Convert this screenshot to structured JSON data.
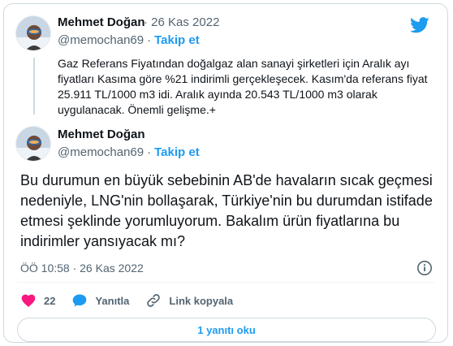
{
  "quoted_tweet": {
    "author_name": "Mehmet Doğan",
    "date": "26 Kas 2022",
    "handle": "@memochan69",
    "follow_label": "Takip et",
    "separator": "·",
    "dot_before_date": "·",
    "text": "Gaz Referans Fiyatından doğalgaz alan sanayi şirketleri için Aralık ayı fiyatları Kasıma göre %21 indirimli gerçekleşecek. Kasım'da referans fiyat 25.911 TL/1000 m3 idi. Aralık ayında 20.543 TL/1000 m3 olarak uygulanacak. Önemli gelişme.+"
  },
  "main_tweet": {
    "author_name": "Mehmet Doğan",
    "handle": "@memochan69",
    "separator": "·",
    "follow_label": "Takip et",
    "text": "Bu durumun en büyük sebebinin AB'de havaların sıcak geçmesi nedeniyle, LNG'nin bollaşarak, Türkiye'nin bu durumdan istifade etmesi şeklinde yorumluyorum. Bakalım ürün fiyatlarına bu indirimler yansıyacak mı?",
    "timestamp": "ÖÖ 10:58 · 26 Kas 2022"
  },
  "actions": {
    "likes_count": "22",
    "reply_label": "Yanıtla",
    "copy_link_label": "Link kopyala"
  },
  "read_replies_label": "1 yanıtı oku",
  "icons": {
    "brand": "twitter-bird-icon",
    "like": "heart-icon",
    "reply": "speech-bubble-icon",
    "link": "link-icon",
    "info": "info-icon"
  },
  "colors": {
    "accent": "#1d9bf0",
    "like": "#f91880",
    "muted": "#536471",
    "text": "#0f1419",
    "border": "#cfd9de"
  }
}
